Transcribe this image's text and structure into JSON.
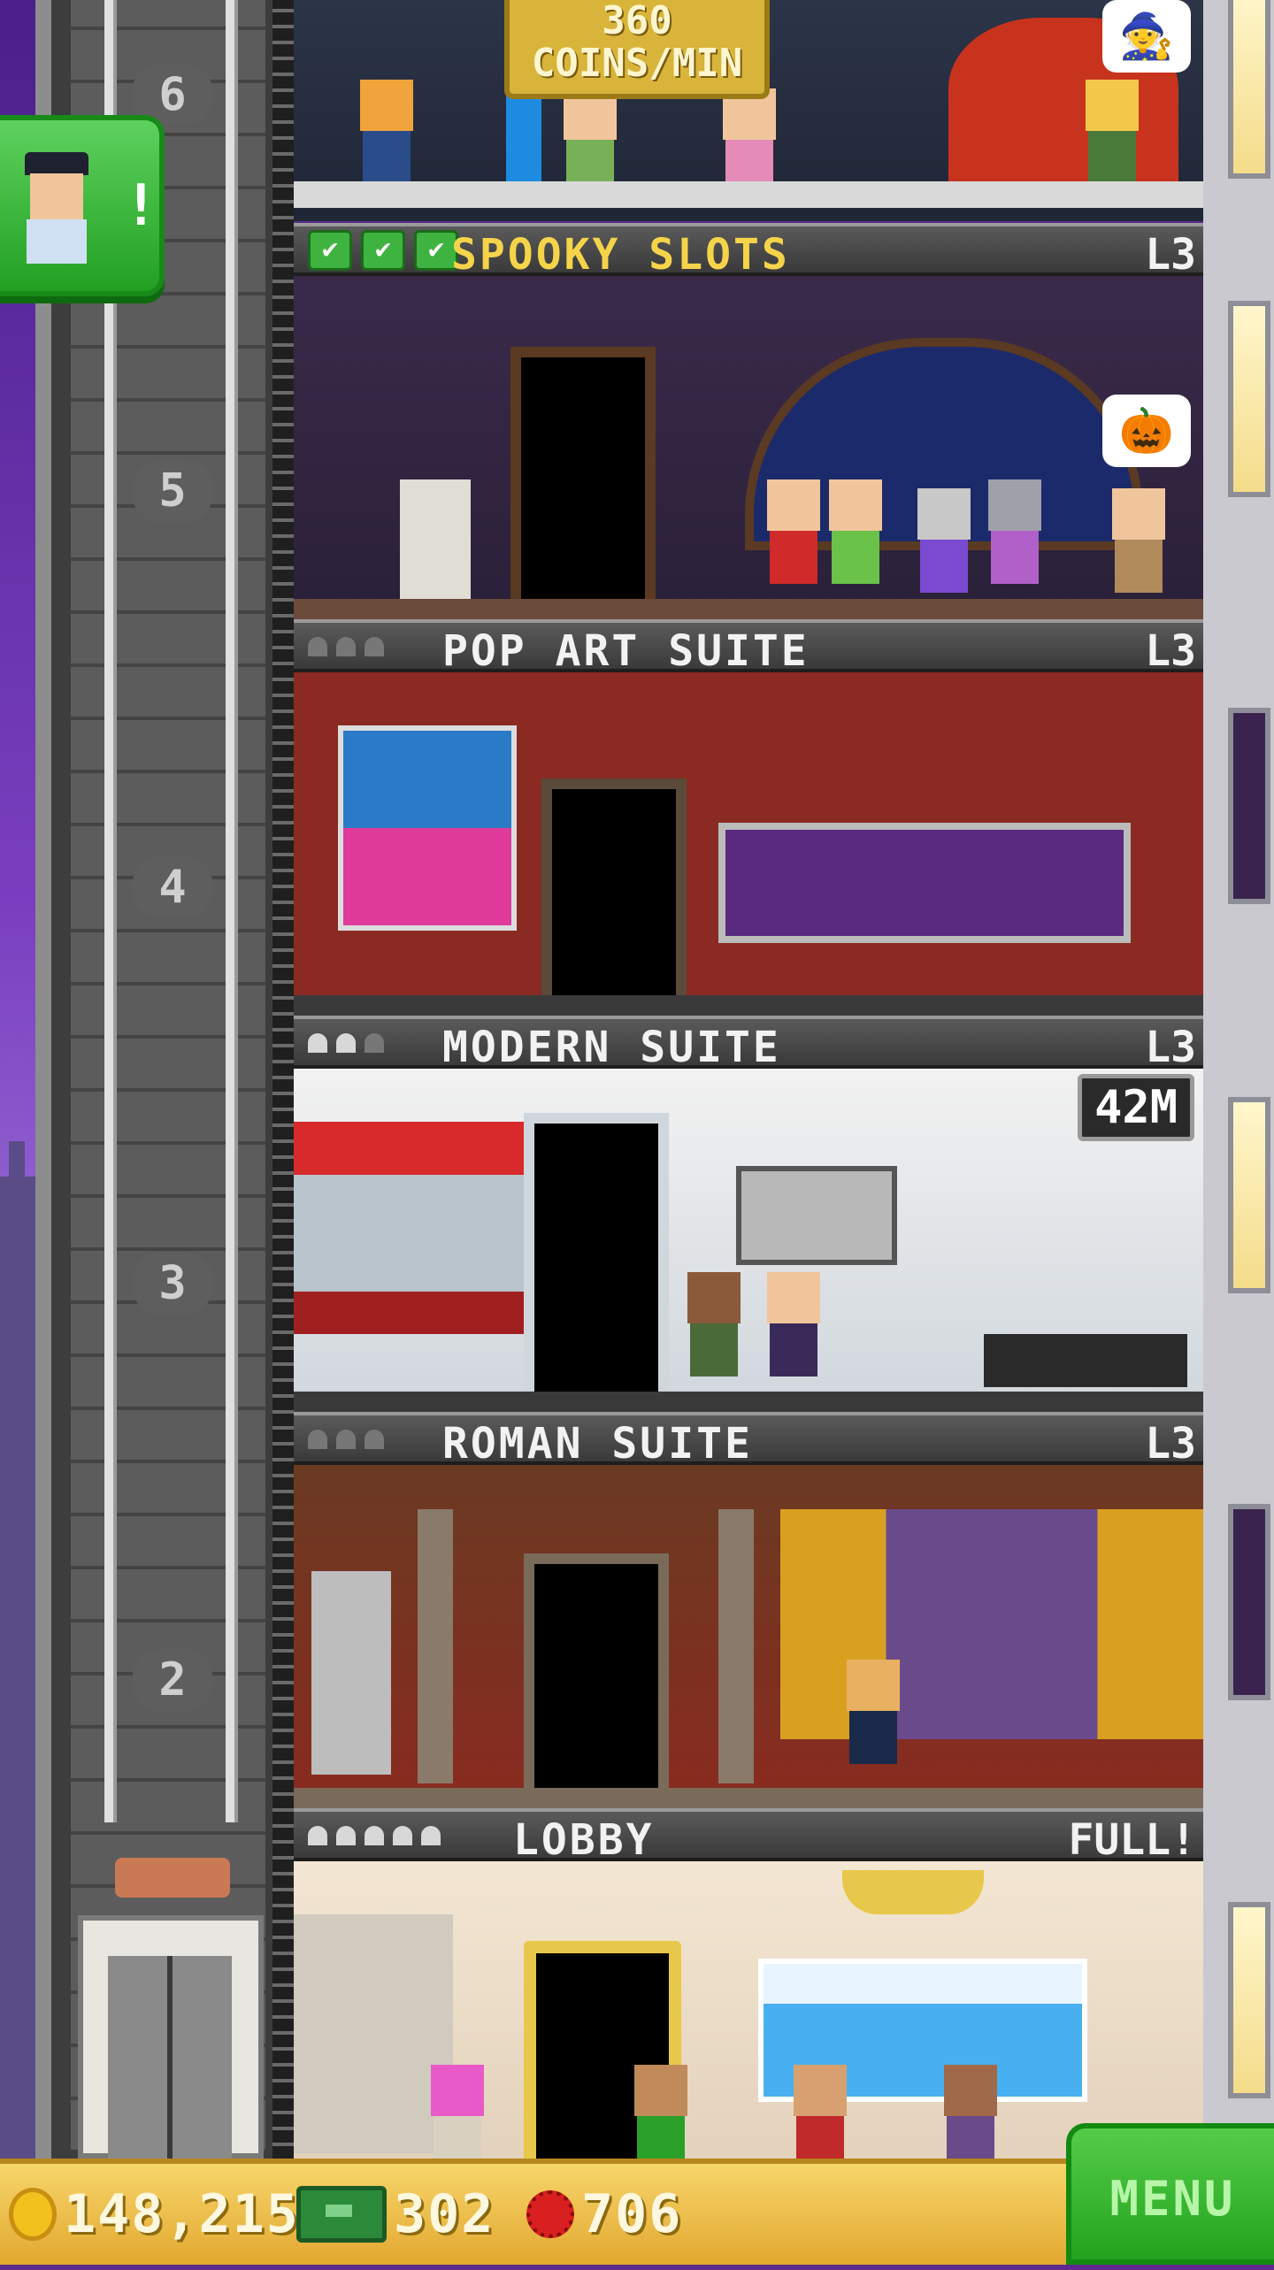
{
  "income_banner": {
    "amount": "360",
    "unit": "COINS/MIN"
  },
  "shaft_floor_numbers": [
    "6",
    "5",
    "4",
    "3",
    "2"
  ],
  "floors": [
    {
      "name": "SPOOKY SLOTS",
      "level": "L3",
      "checks": "✔✔✔",
      "bubble_icon": "pumpkin-icon"
    },
    {
      "name": "POP ART SUITE",
      "level": "L3",
      "occupancy": "0/3"
    },
    {
      "name": "MODERN SUITE",
      "level": "L3",
      "occupancy": "2/3",
      "status_tag": "42M"
    },
    {
      "name": "ROMAN SUITE",
      "level": "L3",
      "occupancy": "0/3"
    },
    {
      "name": "LOBBY",
      "level": "FULL!",
      "occupancy": "5/5"
    }
  ],
  "top_floor_bubble_icon": "gnome-icon",
  "bellhop_alert": "!",
  "bottom_bar": {
    "coins": "148,215",
    "bux": "302",
    "tickets": "706",
    "menu_label": "MENU"
  },
  "colors": {
    "label_bar": "#3a3a3a",
    "spooky_name": "#f5d44a",
    "coin_bar": "#f7d56a",
    "menu_green": "#23a31d"
  }
}
